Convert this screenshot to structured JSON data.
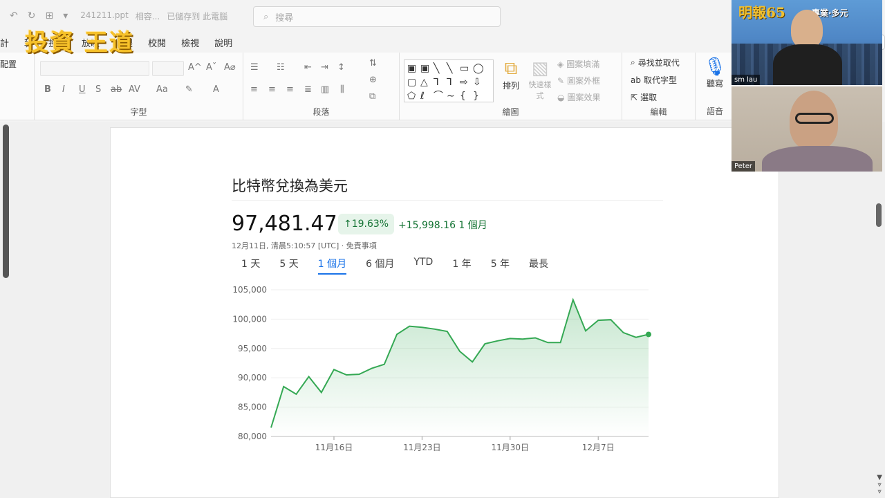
{
  "app": {
    "doc_name": "241211.ppt",
    "doc_mode": "相容...",
    "save_status": "已儲存到 此電腦",
    "search_placeholder": "搜尋",
    "brand": "投資 王道"
  },
  "ribbon": {
    "tabs": [
      "計",
      "轉",
      "投影",
      "放映",
      "錄製",
      "校閱",
      "檢視",
      "說明"
    ],
    "record_label": "錄製",
    "left_label": "配置",
    "groups": {
      "font": "字型",
      "paragraph": "段落",
      "drawing": "繪圖",
      "editing": "編輯",
      "voice": "語音"
    },
    "drawing": {
      "arrange": "排列",
      "quick_style": "快速樣式",
      "shape_fill": "圖案填滿",
      "shape_outline": "圖案外框",
      "shape_effects": "圖案效果"
    },
    "editing": {
      "find_replace": "尋找並取代",
      "replace_font": "取代字型",
      "select": "選取"
    },
    "voice": {
      "dictate": "聽寫"
    }
  },
  "slide": {
    "title": "比特幣兌換為美元",
    "price": "97,481.47",
    "change_pct": "↑19.63%",
    "change_abs": "+15,998.16 1 個月",
    "timestamp": "12月11日, 清晨5:10:57 [UTC] · 免責事項",
    "ranges": [
      "1 天",
      "5 天",
      "1 個月",
      "6 個月",
      "YTD",
      "1 年",
      "5 年",
      "最長"
    ],
    "active_range": "1 個月"
  },
  "chart_data": {
    "type": "area",
    "x": [
      "11月11日",
      "11月12日",
      "11月13日",
      "11月14日",
      "11月15日",
      "11月16日",
      "11月17日",
      "11月18日",
      "11月19日",
      "11月20日",
      "11月21日",
      "11月22日",
      "11月23日",
      "11月24日",
      "11月25日",
      "11月26日",
      "11月27日",
      "11月28日",
      "11月29日",
      "11月30日",
      "12月1日",
      "12月2日",
      "12月3日",
      "12月4日",
      "12月5日",
      "12月6日",
      "12月7日",
      "12月8日",
      "12月9日",
      "12月10日",
      "12月11日"
    ],
    "values": [
      81500,
      88500,
      87200,
      90200,
      87500,
      91400,
      90500,
      90600,
      91600,
      92300,
      97400,
      98800,
      98600,
      98300,
      97900,
      94500,
      92700,
      95800,
      96300,
      96700,
      96600,
      96800,
      96000,
      96000,
      103300,
      98000,
      99800,
      99900,
      97700,
      96900,
      97400
    ],
    "ylim": [
      80000,
      105000
    ],
    "yticks": [
      "80,000",
      "85,000",
      "90,000",
      "95,000",
      "100,000",
      "105,000"
    ],
    "xticks": [
      "11月16日",
      "11月23日",
      "11月30日",
      "12月7日"
    ],
    "line_color": "#34a853",
    "fill_color": "#e6f4ea",
    "grid": true
  },
  "participants": [
    {
      "name": "sm lau",
      "overlay_title": "明報65",
      "overlay_subtitle": "專業·多元"
    },
    {
      "name": "Peter"
    }
  ]
}
